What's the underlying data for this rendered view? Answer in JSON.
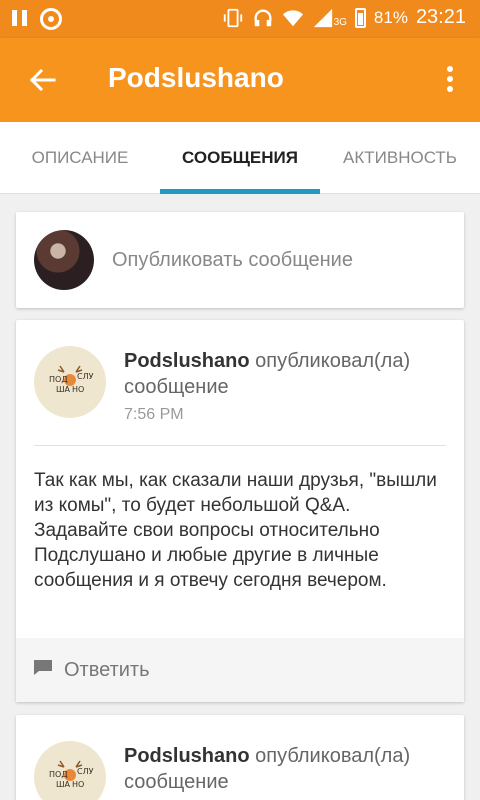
{
  "status_bar": {
    "battery": "81%",
    "time": "23:21",
    "network": "3G"
  },
  "app_bar": {
    "title": "Podslushano",
    "icons": [
      "back-arrow-icon",
      "more-vert-icon"
    ],
    "accent_color": "#f7941d"
  },
  "tabs": [
    {
      "label": "ОПИСАНИЕ",
      "active": false
    },
    {
      "label": "СООБЩЕНИЯ",
      "active": true
    },
    {
      "label": "АКТИВНОСТЬ",
      "active": false
    }
  ],
  "compose": {
    "placeholder": "Опубликовать сообщение"
  },
  "posts": [
    {
      "author": "Podslushano",
      "action": "опубликовал(ла) сообщение",
      "time": "7:56 PM",
      "body": "Так как мы, как сказали наши друзья, \"вышли из комы\", то будет небольшой Q&A. Задавайте свои вопросы относительно Подслушано и любые другие в личные сообщения и я отвечу сегодня вечером.",
      "reply_label": "Ответить"
    },
    {
      "author": "Podslushano",
      "action": "опубликовал(ла) сообщение"
    }
  ],
  "avatar_logo_text": [
    "ПОД",
    "СЛУ",
    "ША",
    "НО"
  ]
}
